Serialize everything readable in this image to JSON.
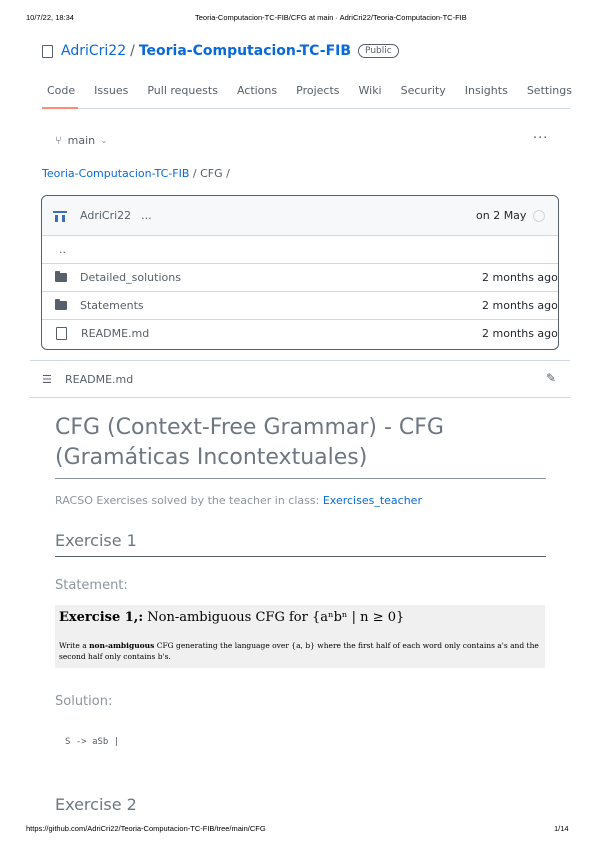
{
  "print": {
    "datetime": "10/7/22, 18:34",
    "doc_title": "Teoria-Computacion-TC-FIB/CFG at main · AdriCri22/Teoria-Computacion-TC-FIB",
    "url": "https://github.com/AdriCri22/Teoria-Computacion-TC-FIB/tree/main/CFG",
    "page": "1/14"
  },
  "repo": {
    "owner": "AdriCri22",
    "separator": "/",
    "name": "Teoria-Computacion-TC-FIB",
    "visibility": "Public"
  },
  "tabs": [
    "Code",
    "Issues",
    "Pull requests",
    "Actions",
    "Projects",
    "Wiki",
    "Security",
    "Insights",
    "Settings"
  ],
  "branch": {
    "name": "main",
    "caret": "⌄"
  },
  "more_icon": "···",
  "breadcrumb": {
    "root": "Teoria-Computacion-TC-FIB",
    "path": " / CFG /"
  },
  "commit": {
    "user": "AdriCri22",
    "ellipsis": "...",
    "date": "on 2 May"
  },
  "files": {
    "parent": "..",
    "items": [
      {
        "name": "Detailed_solutions",
        "age": "2 months ago",
        "icon": "folder-icon"
      },
      {
        "name": "Statements",
        "age": "2 months ago",
        "icon": "folder-icon"
      },
      {
        "name": "README.md",
        "age": "2 months ago",
        "icon": "file-icon"
      }
    ]
  },
  "readme": {
    "filename": "README.md",
    "title": "CFG (Context-Free Grammar) - CFG (Gramáticas Incontextuales)",
    "desc_text": "RACSO Exercises solved by the teacher in class: ",
    "desc_link": "Exercises_teacher",
    "ex1_heading": "Exercise 1",
    "statement_heading": "Statement:",
    "ex1_title_bold": "Exercise 1,:",
    "ex1_title_rest": " Non-ambiguous CFG for {aⁿbⁿ | n ≥ 0}",
    "ex1_text_a": "Write a ",
    "ex1_text_bold": "non-ambiguous",
    "ex1_text_b": " CFG generating the language over {a, b} where the first half of each word only contains a's and the second half only contains b's.",
    "solution_heading": "Solution:",
    "solution_code": "S -> aSb |",
    "ex2_heading": "Exercise 2"
  }
}
